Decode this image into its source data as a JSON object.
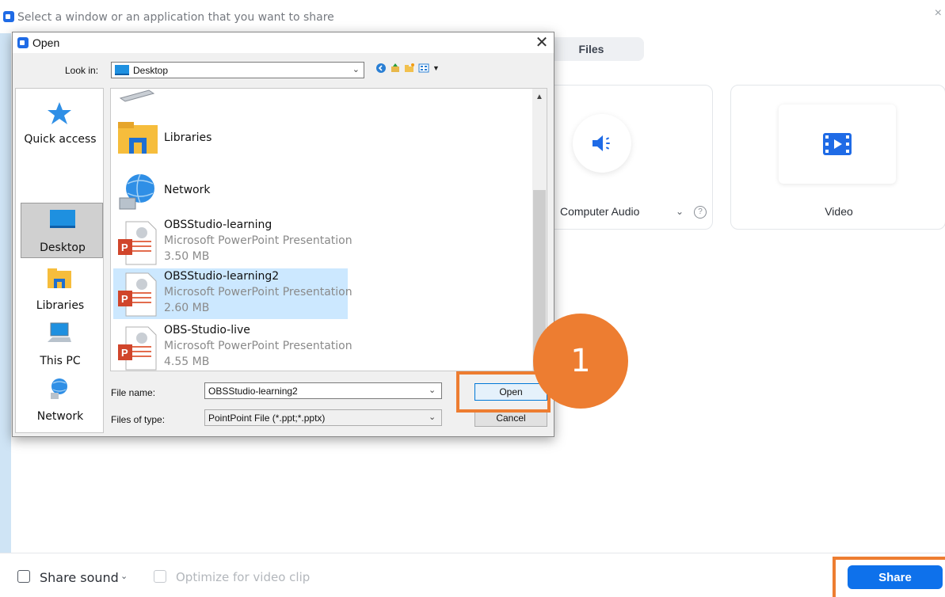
{
  "share_window": {
    "title": "Select a window or an application that you want to share",
    "close_glyph": "×",
    "tab_files": "Files",
    "card_audio_label": "Computer Audio",
    "card_audio_help": "?",
    "card_video_label": "Video",
    "footer": {
      "share_sound_label": "Share sound",
      "optimize_label": "Optimize for video clip",
      "share_button": "Share"
    }
  },
  "open_dialog": {
    "title": "Open",
    "close_glyph": "✕",
    "look_in_label": "Look in:",
    "look_in_value": "Desktop",
    "places": [
      {
        "label": "Quick access",
        "icon": "star-icon"
      },
      {
        "label": "Desktop",
        "icon": "desktop-icon",
        "selected": true
      },
      {
        "label": "Libraries",
        "icon": "libraries-icon"
      },
      {
        "label": "This PC",
        "icon": "computer-icon"
      },
      {
        "label": "Network",
        "icon": "network-icon"
      }
    ],
    "items": [
      {
        "name": "Libraries",
        "icon": "libraries-folder-icon"
      },
      {
        "name": "Network",
        "icon": "network-globe-icon"
      },
      {
        "name": "OBSStudio-learning",
        "type": "Microsoft PowerPoint Presentation",
        "size": "3.50 MB",
        "icon": "powerpoint-file-icon"
      },
      {
        "name": "OBSStudio-learning2",
        "type": "Microsoft PowerPoint Presentation",
        "size": "2.60 MB",
        "icon": "powerpoint-file-icon",
        "selected": true
      },
      {
        "name": "OBS-Studio-live",
        "type": "Microsoft PowerPoint Presentation",
        "size": "4.55 MB",
        "icon": "powerpoint-file-icon"
      }
    ],
    "file_name_label": "File name:",
    "file_name_value": "OBSStudio-learning2",
    "files_of_type_label": "Files of type:",
    "files_of_type_value": "PointPoint File (*.ppt;*.pptx)",
    "open_button": "Open",
    "cancel_button": "Cancel"
  },
  "annotation": {
    "step_number": "1",
    "highlight_color": "#ed7d31"
  },
  "colors": {
    "accent": "#0e71eb",
    "selection": "#cce8ff"
  }
}
